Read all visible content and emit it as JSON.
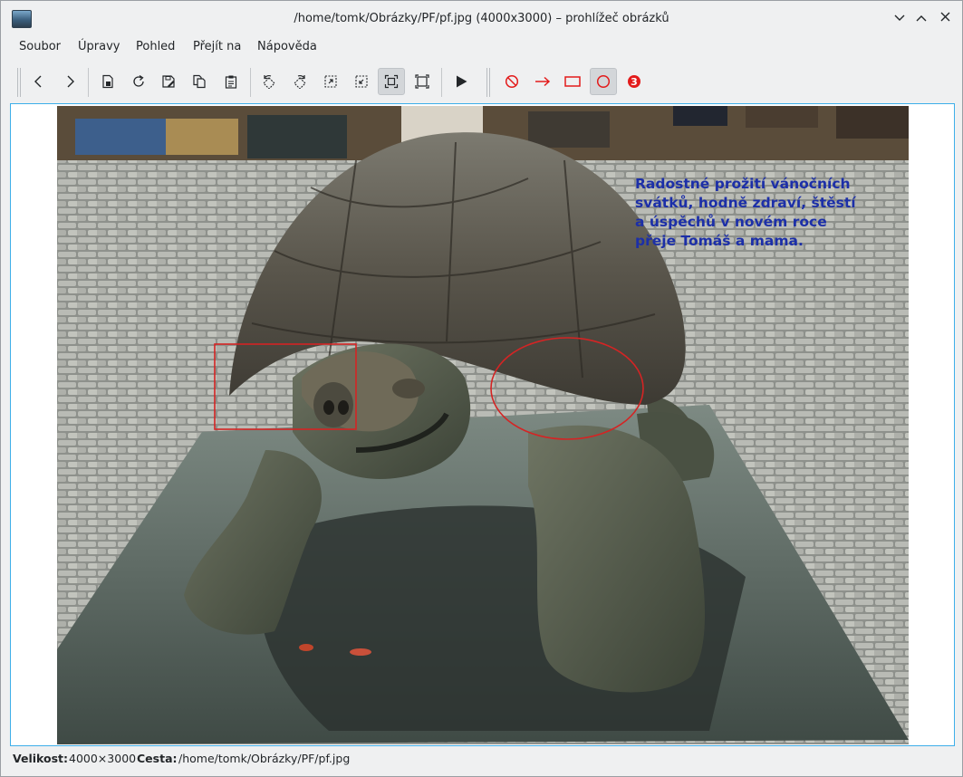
{
  "window": {
    "title": "/home/tomk/Obrázky/PF/pf.jpg (4000x3000) – prohlížeč obrázků",
    "controls": [
      "minimize",
      "maximize",
      "close"
    ]
  },
  "menu": {
    "file": "Soubor",
    "edit": "Úpravy",
    "view": "Pohled",
    "go": "Přejít na",
    "help": "Nápověda"
  },
  "toolbar": {
    "icons": [
      "chevron-left-icon",
      "chevron-right-icon",
      "file-icon",
      "reload-icon",
      "save-as-icon",
      "copy-icon",
      "clipboard-icon",
      "rotate-left-icon",
      "rotate-right-icon",
      "zoom-fit-icon",
      "zoom-original-icon",
      "zoom-to-fit-icon",
      "fullscreen-icon",
      "slideshow-icon",
      "no-annotation-icon",
      "arrow-annotation-icon",
      "rectangle-annotation-icon",
      "ellipse-annotation-icon",
      "number-annotation-icon"
    ],
    "number_badge": "3",
    "accent": "#e31b1b"
  },
  "image": {
    "greeting_text": "Radostné prožití vánočních\nsvátků, hodně zdraví, štěstí\na úspěchů v novém roce\npřeje Tomáš a mama.",
    "greeting_color": "#1c2fa8",
    "annotation_color": "#d42424"
  },
  "status": {
    "size_label": "Velikost:",
    "size_value": "4000×3000",
    "path_label": "Cesta:",
    "path_value": "/home/tomk/Obrázky/PF/pf.jpg"
  }
}
